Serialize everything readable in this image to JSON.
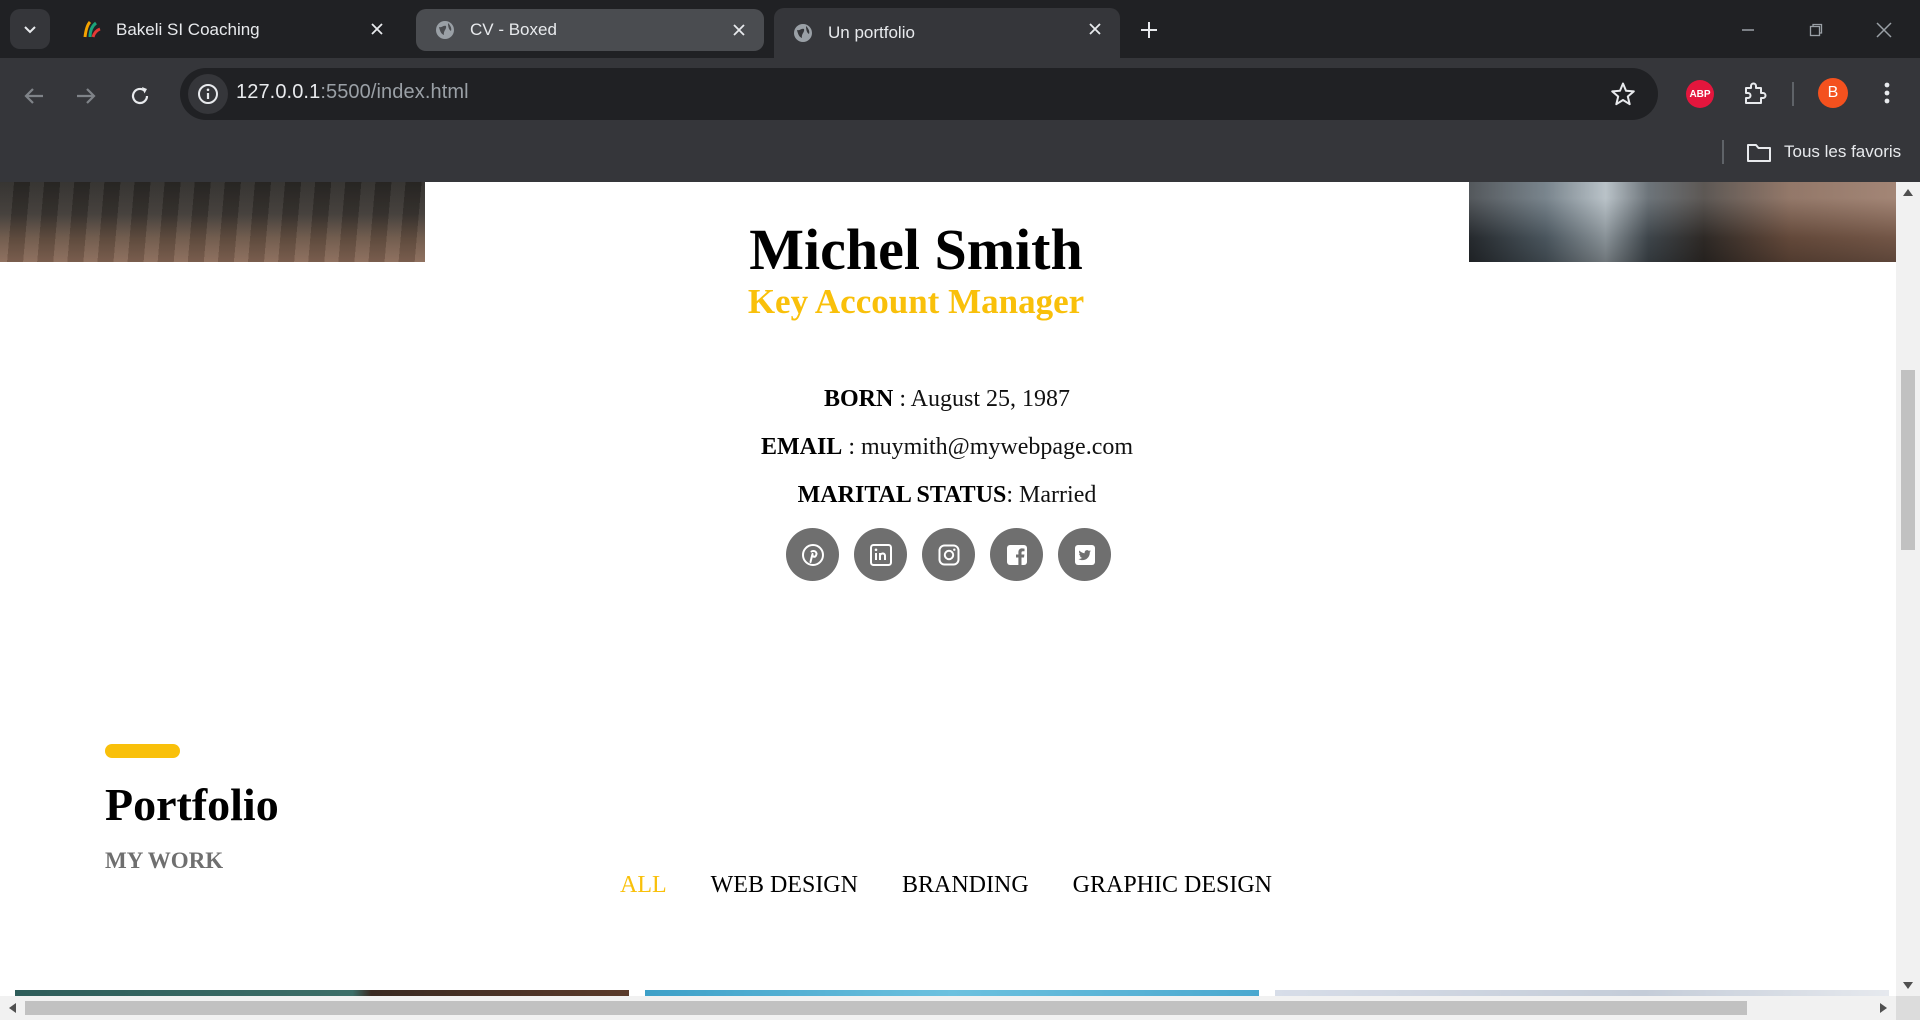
{
  "browser": {
    "tabs": [
      {
        "title": "Bakeli SI Coaching",
        "icon": "bakeli-logo-icon",
        "active": false
      },
      {
        "title": "CV - Boxed",
        "icon": "globe-icon",
        "active": false,
        "hovered": true
      },
      {
        "title": "Un portfolio",
        "icon": "globe-icon",
        "active": true
      }
    ],
    "url_host": "127.0.0.1",
    "url_path": ":5500/index.html",
    "bookmarks_all": "Tous les favoris",
    "profile_initial": "B",
    "abp_label": "ABP"
  },
  "profile": {
    "name": "Michel Smith",
    "role": "Key Account Manager",
    "born_label": "BORN",
    "born_value": " : August 25, 1987",
    "email_label": "EMAIL",
    "email_value": " : muymith@mywebpage.com",
    "marital_label": "MARITAL STATUS",
    "marital_value": ": Married",
    "socials": [
      "pinterest-icon",
      "linkedin-icon",
      "instagram-icon",
      "facebook-icon",
      "twitter-icon"
    ]
  },
  "portfolio": {
    "title": "Portfolio",
    "subtitle": "MY WORK",
    "filters": [
      "ALL",
      "WEB DESIGN",
      "BRANDING",
      "GRAPHIC DESIGN"
    ],
    "active_filter": "ALL"
  },
  "colors": {
    "accent": "#f9c00a",
    "social_bg": "#6f6f6f",
    "chrome_dark": "#202124",
    "chrome_toolbar": "#35363a"
  }
}
